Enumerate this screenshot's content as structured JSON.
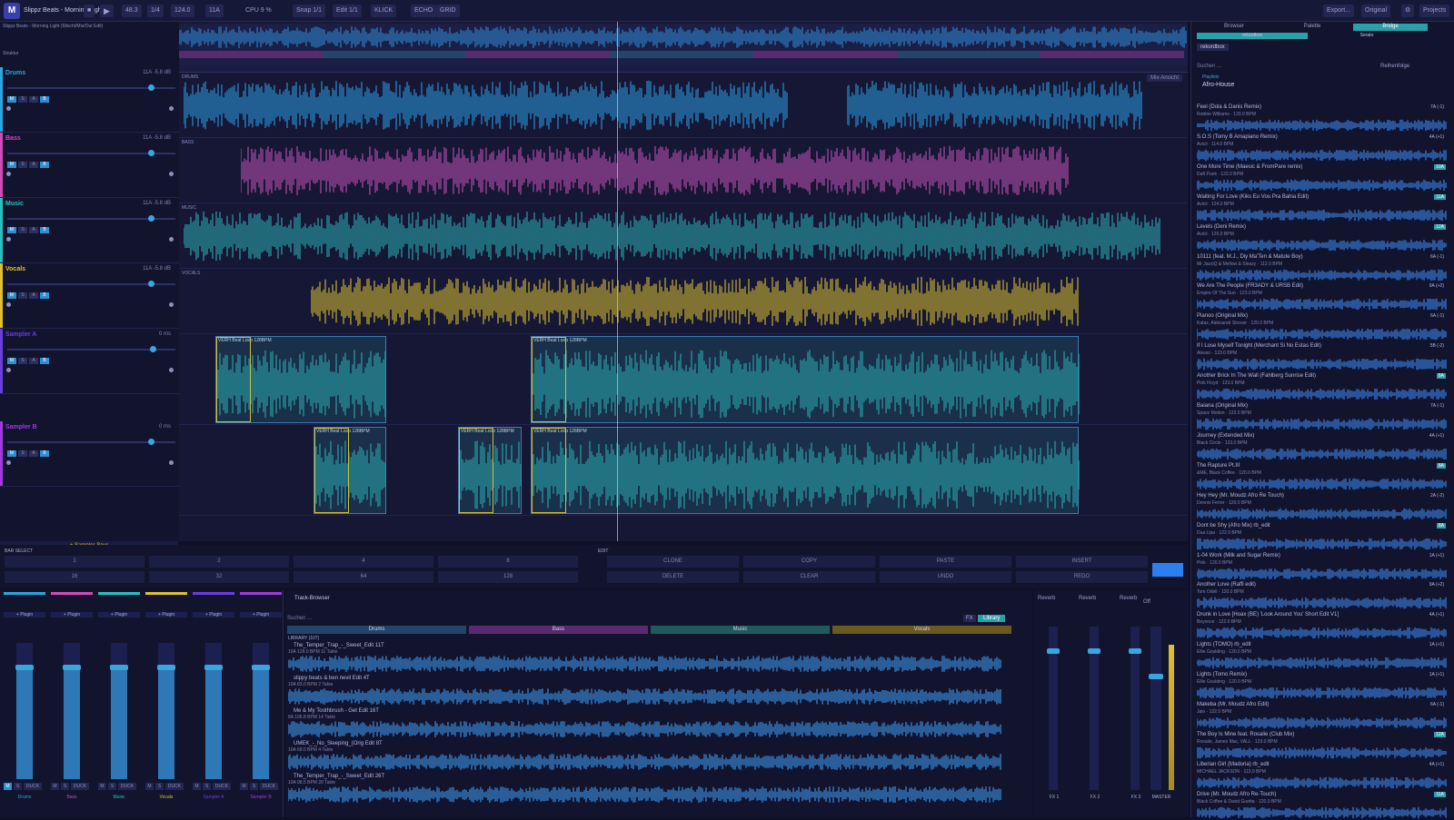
{
  "app": {
    "title": "Slippz Beats - Morning Light",
    "subtitle": "Slippz Beats - Morning Light (Mischt/Mix/Out Edit)",
    "structure_label": "Struktur"
  },
  "toolbar": {
    "bpm": "48.3",
    "beats": "1/4",
    "tempo": "124.0",
    "key": "11A",
    "cpu": "CPU 9 %",
    "snap": "Snap 1/1",
    "edit": "Edit 1/1",
    "klick": "KLICK",
    "echo": "ECHO",
    "grid": "GRID",
    "export": "Export...",
    "original": "Original",
    "projects": "Projects"
  },
  "tracks": [
    {
      "name": "Drums",
      "meta": "11A  -5.8 dB",
      "color": "#2aa7e0",
      "fader": 0.84
    },
    {
      "name": "Bass",
      "meta": "11A  -5.8 dB",
      "color": "#d04ab8",
      "fader": 0.84
    },
    {
      "name": "Music",
      "meta": "11A  -5.8 dB",
      "color": "#2ac0c0",
      "fader": 0.84
    },
    {
      "name": "Vocals",
      "meta": "11A  -5.8 dB",
      "color": "#e0c030",
      "fader": 0.84
    },
    {
      "name": "Sampler A",
      "meta": "0 ms",
      "color": "#6a3de0",
      "fader": 0.85
    },
    {
      "name": "Sampler B",
      "meta": "0 ms",
      "color": "#a03ae0",
      "fader": 0.84
    }
  ],
  "lane_labels": [
    "DRUMS",
    "BASS",
    "MUSIC",
    "VOCALS"
  ],
  "clips": {
    "sampler_a": [
      "VERH Beat Loop 128BPM",
      "VERH Beat Loop 128BPM"
    ],
    "sampler_b": [
      "VERH Beat Loop 128BPM",
      "VERH Beat Loop 128BPM",
      "VERH Beat Loop 128BPM"
    ]
  },
  "mix_view": "Mix-Ansicht",
  "add_sampler": "+ Sampler-Spur",
  "bar_select": {
    "label": "BAR SELECT",
    "row1": [
      "1",
      "2",
      "4",
      "8"
    ],
    "row2": [
      "16",
      "32",
      "64",
      "128"
    ],
    "edit_label": "EDIT",
    "edit1": [
      "CLONE",
      "COPY",
      "PASTE",
      "INSERT"
    ],
    "edit2": [
      "DELETE",
      "CLEAR",
      "UNDO",
      "REDO"
    ]
  },
  "mixer": {
    "strips": [
      "Drums",
      "Bass",
      "Music",
      "Vocals",
      "Sampler A",
      "Sampler B"
    ],
    "plugin_label": "+ Plugin",
    "duck": "DUCK"
  },
  "track_browser": {
    "title": "Track-Browser",
    "search_placeholder": "Suchen ...",
    "fx": "FX",
    "library": "Library",
    "tabs": [
      "Drums",
      "Bass",
      "Music",
      "Vocals"
    ],
    "library_label": "LIBRARY (107)",
    "items": [
      {
        "title": "The_Temper_Trap_-_Sweet_Edit 11T",
        "meta": "10A  128.0 BPM  11 Takte"
      },
      {
        "title": "slippy beats & ben nevil Edit 4T",
        "meta": "10A  83.0 BPM  2 Takte"
      },
      {
        "title": "Me & My Toothbrush - Get Edit 16T",
        "meta": "8A  106.8 BPM  14 Takte"
      },
      {
        "title": "UMEK_-_No_Sleeping_(Orig Edit 8T",
        "meta": "10A  68.0 BPM  4 Takte"
      },
      {
        "title": "The_Temper_Trap_-_Sweet_Edit 26T",
        "meta": "10A  98.5 BPM  20 Takte"
      }
    ]
  },
  "fx": {
    "units": [
      "Reverb",
      "Reverb",
      "Reverb"
    ],
    "labels": [
      "FX 1",
      "FX 2",
      "FX 3"
    ],
    "master": "MASTER",
    "off": "Off"
  },
  "sidebar": {
    "tabs": [
      "Browser",
      "Palette",
      "Bridge"
    ],
    "subtabs": [
      "rekordbox",
      "Serato"
    ],
    "source": "rekordbox",
    "search_placeholder": "Suchen ...",
    "sort": "Reihenfolge",
    "playlist_label": "Playlists",
    "playlist": "Afro-House",
    "online": "online",
    "songs": [
      {
        "title": "Feel (Dola & Danis Remix)",
        "meta": "Robbie Williams · 120.0 BPM",
        "key": "7A (-1)",
        "hi": false
      },
      {
        "title": "S.O.S (Tomy B Amapiano Remix)",
        "meta": "Avicii · 114.0 BPM",
        "key": "4A (+1)",
        "hi": false
      },
      {
        "title": "One More Time (Maesic & FromPare remix)",
        "meta": "Daft Punk · 122.0 BPM",
        "key": "10A",
        "hi": true
      },
      {
        "title": "Waiting For Love (Kiks Eu Vou Pra Bahia Edit)",
        "meta": "Avicii · 124.0 BPM",
        "key": "11A",
        "hi": true
      },
      {
        "title": "Levels (Deni Remix)",
        "meta": "Avicii · 120.0 BPM",
        "key": "12A",
        "hi": true
      },
      {
        "title": "10111 (feat. M.J., Diy Ma'Ten & Matute Boy)",
        "meta": "Mr JazziQ & Mellow & Sleazy · 112.0 BPM",
        "key": "6A (-1)",
        "hi": false
      },
      {
        "title": "We Are The People (FR3ADY & URSB Edit)",
        "meta": "Empire Of The Sun · 123.0 BPM",
        "key": "9A (+2)",
        "hi": false
      },
      {
        "title": "Pianoo (Original Mix)",
        "meta": "Kataz, Aleksandr Strover · 120.0 BPM",
        "key": "6A (-1)",
        "hi": false
      },
      {
        "title": "If I Lose Myself Tonight (Merchant Si No Estas Edit)",
        "meta": "Alesso · 123.0 BPM",
        "key": "5B (-2)",
        "hi": false
      },
      {
        "title": "Another Brick In The Wall (Fahlberg Sunrise Edit)",
        "meta": "Pink Floyd · 123.0 BPM",
        "key": "8A",
        "hi": true
      },
      {
        "title": "Baiana (Original Mix)",
        "meta": "Space Motion · 122.0 BPM",
        "key": "7A (-1)",
        "hi": false
      },
      {
        "title": "Journey (Extended Mix)",
        "meta": "Black Circle · 123.0 BPM",
        "key": "4A (+1)",
        "hi": false
      },
      {
        "title": "The Rapture Pt.III",
        "meta": "&ME, Black Coffee · 120.0 BPM",
        "key": "8A",
        "hi": true
      },
      {
        "title": "Hey Hey (Mr. Moudz Afro Re Touch)",
        "meta": "Dennis Ferrer · 120.0 BPM",
        "key": "2A (-2)",
        "hi": false
      },
      {
        "title": "Dont be Shy (Afro Mix) rb_edit",
        "meta": "Dua Lipa · 122.0 BPM",
        "key": "8A",
        "hi": true
      },
      {
        "title": "1-04 Work (Milk and Sugar Remix)",
        "meta": "Pink · 120.0 BPM",
        "key": "1A (+1)",
        "hi": false
      },
      {
        "title": "Another Love (Raffi edit)",
        "meta": "Tom Odell · 120.0 BPM",
        "key": "9A (+2)",
        "hi": false
      },
      {
        "title": "Drunk in Love [Hoax (BE) 'Look Around You' Short Edit V1]",
        "meta": "Beyonce · 122.0 BPM",
        "key": "4A (+1)",
        "hi": false
      },
      {
        "title": "Lights (TOMO) rb_edit",
        "meta": "Ellie Goulding · 120.0 BPM",
        "key": "1A (+1)",
        "hi": false
      },
      {
        "title": "Lights (Tomo Remix)",
        "meta": "Ellie Goulding · 120.0 BPM",
        "key": "1A (+1)",
        "hi": false
      },
      {
        "title": "Makeba (Mr. Moudz Afro Edit)",
        "meta": "Jain · 122.0 BPM",
        "key": "6A (-1)",
        "hi": false
      },
      {
        "title": "The Boy Is Mine feat. Rosalie (Club Mix)",
        "meta": "Rosalie, James Mac, VALL · 123.0 BPM",
        "key": "12A",
        "hi": true
      },
      {
        "title": "Liberian Girl (Madoria) rb_edit",
        "meta": "MICHAEL JACKSON · 113.0 BPM",
        "key": "4A (+1)",
        "hi": false
      },
      {
        "title": "Drive (Mr. Moudz Afro Re-Touch)",
        "meta": "Black Coffee & David Guetta · 120.0 BPM",
        "key": "11A",
        "hi": true
      }
    ]
  }
}
